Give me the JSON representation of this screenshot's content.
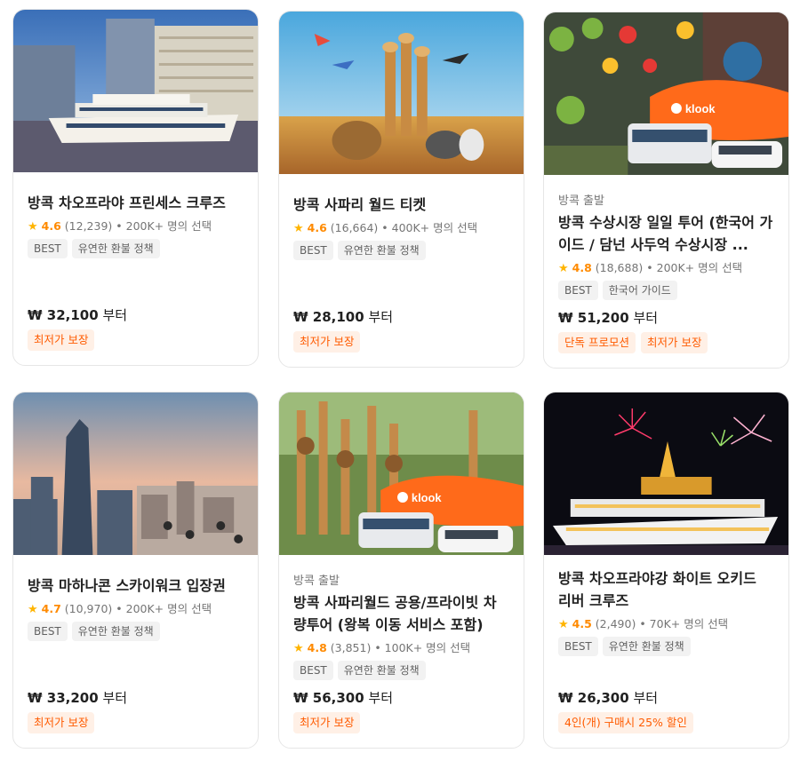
{
  "cards": [
    {
      "departure": "",
      "title": "방콕 차오프라야 프린세스 크루즈",
      "rating": "4.6",
      "reviews": "(12,239)",
      "booked": "• 200K+ 명의 선택",
      "tags": [
        "BEST",
        "유연한 환불 정책"
      ],
      "price": "₩ 32,100",
      "price_suffix": "부터",
      "promos": [
        "최저가 보장"
      ]
    },
    {
      "departure": "",
      "title": "방콕 사파리 월드 티켓",
      "rating": "4.6",
      "reviews": "(16,664)",
      "booked": "• 400K+ 명의 선택",
      "tags": [
        "BEST",
        "유연한 환불 정책"
      ],
      "price": "₩ 28,100",
      "price_suffix": "부터",
      "promos": [
        "최저가 보장"
      ]
    },
    {
      "departure": "방콕 출발",
      "title": "방콕 수상시장 일일 투어 (한국어 가이드 / 담넌 사두억 수상시장 ...",
      "rating": "4.8",
      "reviews": "(18,688)",
      "booked": "• 200K+ 명의 선택",
      "tags": [
        "BEST",
        "한국어 가이드"
      ],
      "price": "₩ 51,200",
      "price_suffix": "부터",
      "promos": [
        "단독 프로모션",
        "최저가 보장"
      ],
      "image_logo": "klook"
    },
    {
      "departure": "",
      "title": "방콕 마하나콘 스카이워크 입장권",
      "rating": "4.7",
      "reviews": "(10,970)",
      "booked": "• 200K+ 명의 선택",
      "tags": [
        "BEST",
        "유연한 환불 정책"
      ],
      "price": "₩ 33,200",
      "price_suffix": "부터",
      "promos": [
        "최저가 보장"
      ]
    },
    {
      "departure": "방콕 출발",
      "title": "방콕 사파리월드 공용/프라이빗 차량투어 (왕복 이동 서비스 포함)",
      "rating": "4.8",
      "reviews": "(3,851)",
      "booked": "• 100K+ 명의 선택",
      "tags": [
        "BEST",
        "유연한 환불 정책"
      ],
      "price": "₩ 56,300",
      "price_suffix": "부터",
      "promos": [
        "최저가 보장"
      ],
      "image_logo": "klook"
    },
    {
      "departure": "",
      "title": "방콕 차오프라야강 화이트 오키드 리버 크루즈",
      "rating": "4.5",
      "reviews": "(2,490)",
      "booked": "• 70K+ 명의 선택",
      "tags": [
        "BEST",
        "유연한 환불 정책"
      ],
      "price": "₩ 26,300",
      "price_suffix": "부터",
      "promos": [
        "4인(개) 구매시 25% 할인"
      ]
    }
  ],
  "colors": {
    "rating": "#ff8a00",
    "star": "#ffb400",
    "promo_text": "#ff5b00",
    "promo_bg": "#fff0e6",
    "klook_orange": "#ff5b00"
  },
  "icons": {
    "star": "star-icon",
    "klook": "klook-logo-icon"
  }
}
